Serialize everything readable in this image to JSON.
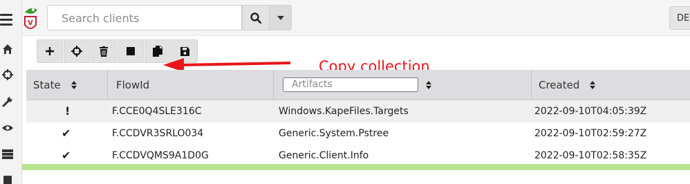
{
  "search": {
    "placeholder": "Search clients"
  },
  "topbar": {
    "user_button_label": "DE"
  },
  "annotation": {
    "text": "Copy collection"
  },
  "table": {
    "headers": {
      "state": "State",
      "flowid": "FlowId",
      "artifacts_placeholder": "Artifacts",
      "created": "Created"
    },
    "rows": [
      {
        "state": "!",
        "flowid": "F.CCE0Q4SLE316C",
        "artifacts": "Windows.KapeFiles.Targets",
        "created": "2022-09-10T04:05:39Z"
      },
      {
        "state": "✔",
        "flowid": "F.CCDVR3SRLO034",
        "artifacts": "Generic.System.Pstree",
        "created": "2022-09-10T02:59:27Z"
      },
      {
        "state": "✔",
        "flowid": "F.CCDVQMS9A1D0G",
        "artifacts": "Generic.Client.Info",
        "created": "2022-09-10T02:58:35Z"
      }
    ]
  },
  "toolbar_icons": [
    "plus-icon",
    "crosshair-icon",
    "trash-icon",
    "stop-icon",
    "copy-icon",
    "save-icon"
  ],
  "colors": {
    "annotation": "#e8161b",
    "progress_bar": "#b6e48f",
    "header_bg": "#dcdde0"
  }
}
